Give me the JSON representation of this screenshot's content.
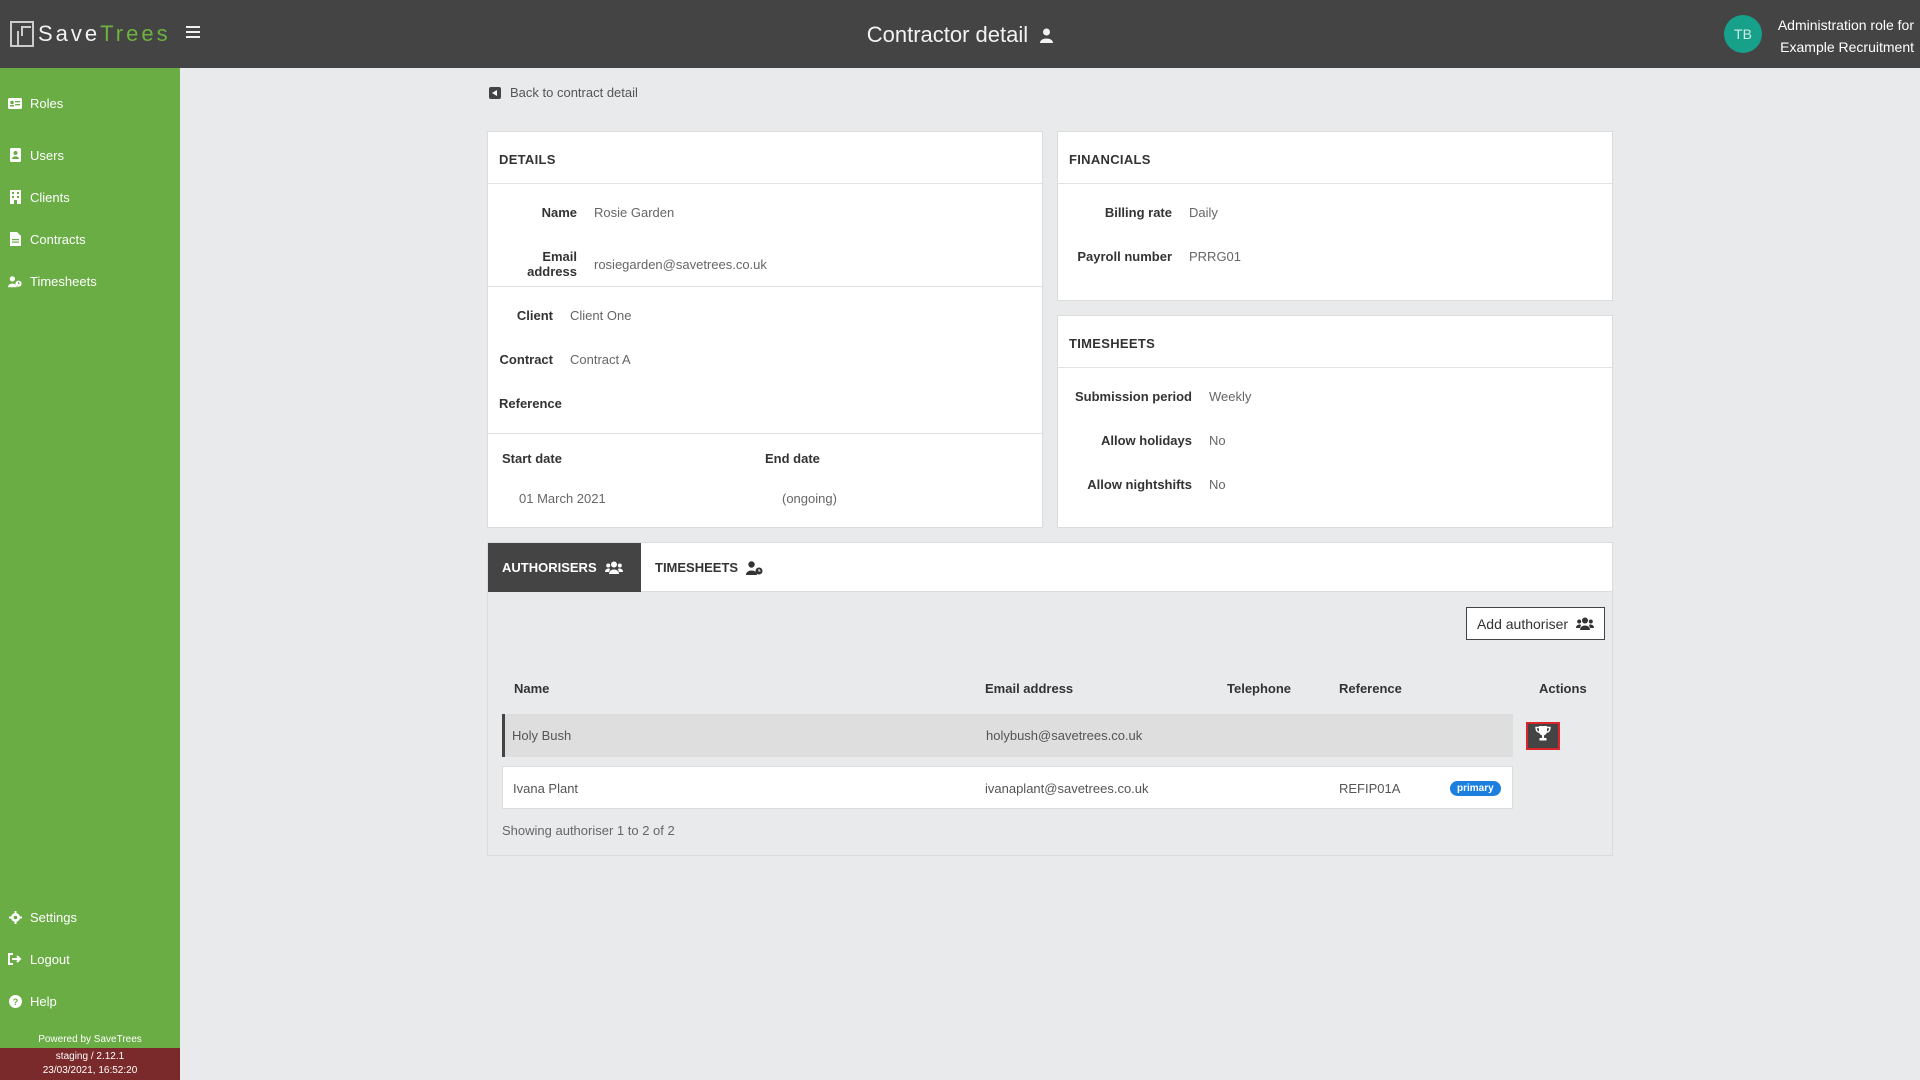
{
  "header": {
    "logo_save": "Save",
    "logo_trees": "Trees",
    "title": "Contractor detail",
    "avatar_initials": "TB",
    "role_line1": "Administration role for",
    "role_line2": "Example Recruitment"
  },
  "sidebar": {
    "items": [
      {
        "label": "Roles",
        "icon": "id-card-icon"
      },
      {
        "label": "Users",
        "icon": "user-book-icon"
      },
      {
        "label": "Clients",
        "icon": "building-icon"
      },
      {
        "label": "Contracts",
        "icon": "file-icon"
      },
      {
        "label": "Timesheets",
        "icon": "user-clock-icon"
      }
    ],
    "bottom_items": [
      {
        "label": "Settings",
        "icon": "gear-icon"
      },
      {
        "label": "Logout",
        "icon": "logout-icon"
      },
      {
        "label": "Help",
        "icon": "question-icon"
      }
    ],
    "powered_by": "Powered by SaveTrees",
    "environment": "staging / 2.12.1",
    "build_time": "23/03/2021, 16:52:20"
  },
  "back_link": "Back to contract detail",
  "details": {
    "heading": "DETAILS",
    "name_label": "Name",
    "name_value": "Rosie Garden",
    "email_label": "Email address",
    "email_value": "rosiegarden@savetrees.co.uk",
    "client_label": "Client",
    "client_value": "Client One",
    "contract_label": "Contract",
    "contract_value": "Contract A",
    "reference_label": "Reference",
    "reference_value": "",
    "start_label": "Start date",
    "start_value": "01 March 2021",
    "end_label": "End date",
    "end_value": "(ongoing)"
  },
  "financials": {
    "heading": "FINANCIALS",
    "billing_label": "Billing rate",
    "billing_value": "Daily",
    "payroll_label": "Payroll number",
    "payroll_value": "PRRG01"
  },
  "timesheets_card": {
    "heading": "TIMESHEETS",
    "submission_label": "Submission period",
    "submission_value": "Weekly",
    "holidays_label": "Allow holidays",
    "holidays_value": "No",
    "nightshifts_label": "Allow nightshifts",
    "nightshifts_value": "No"
  },
  "tabs": [
    {
      "label": "AUTHORISERS",
      "active": true
    },
    {
      "label": "TIMESHEETS",
      "active": false
    }
  ],
  "add_authoriser_label": "Add authoriser",
  "table": {
    "columns": [
      "Name",
      "Email address",
      "Telephone",
      "Reference",
      "Actions"
    ],
    "rows": [
      {
        "name": "Holy Bush",
        "email": "holybush@savetrees.co.uk",
        "telephone": "",
        "reference": "",
        "badge": ""
      },
      {
        "name": "Ivana Plant",
        "email": "ivanaplant@savetrees.co.uk",
        "telephone": "",
        "reference": "REFIP01A",
        "badge": "primary"
      }
    ],
    "footer": "Showing authoriser 1 to 2 of 2"
  },
  "colors": {
    "topbar": "#444444",
    "sidebar": "#6aad45",
    "accent_green": "#6db33f",
    "badge_blue": "#1b7fe0",
    "highlight_red": "#d9262b"
  }
}
